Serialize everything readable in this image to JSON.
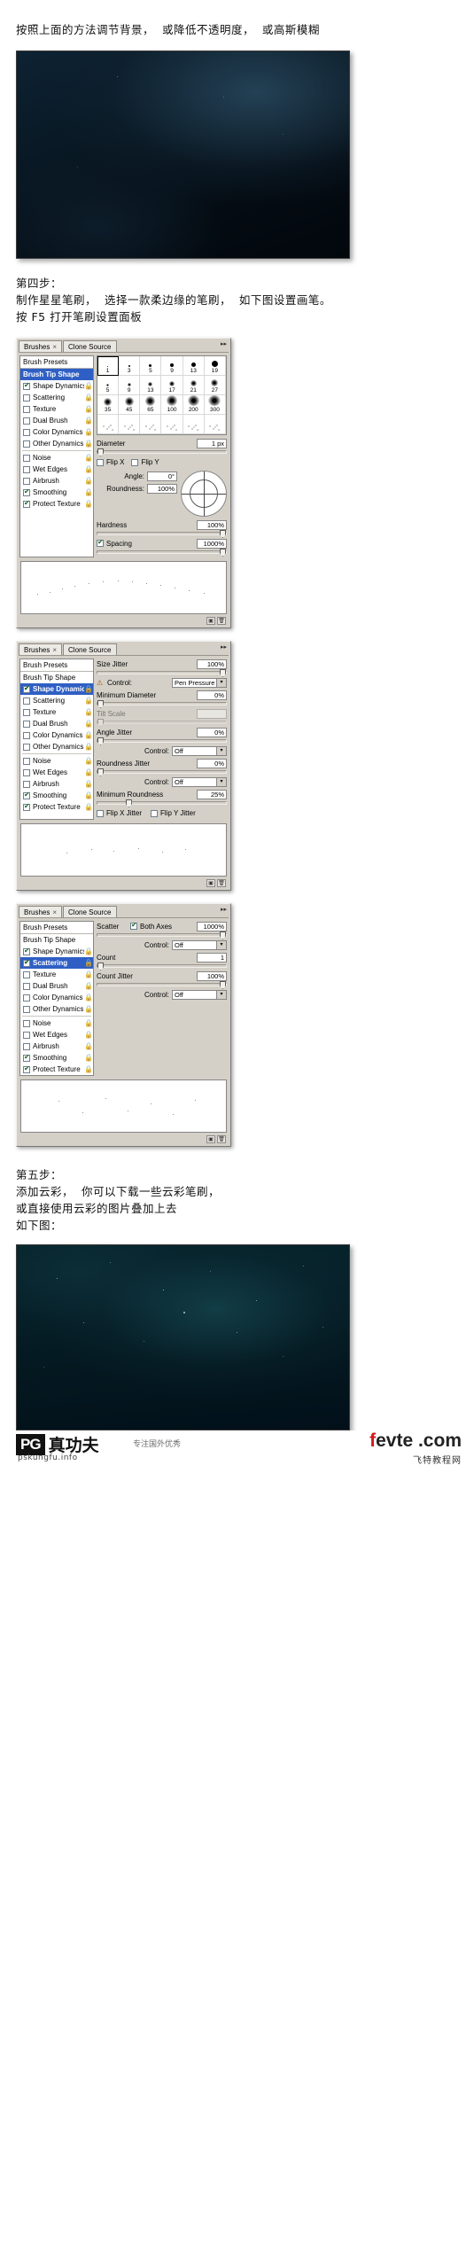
{
  "intro": {
    "line1": "按照上面的方法调节背景，  或降低不透明度，  或高斯模糊"
  },
  "step4": {
    "heading": "第四步：",
    "line1": "制作星星笔刷，  选择一款柔边缘的笔刷，  如下图设置画笔。",
    "line2": "按 F5 打开笔刷设置面板"
  },
  "step5": {
    "heading": "第五步：",
    "line1": "添加云彩，  你可以下载一些云彩笔刷，",
    "line2": "或直接使用云彩的图片叠加上去",
    "line3": "如下图："
  },
  "panel_common": {
    "tabs": [
      {
        "label": "Brushes",
        "close": "×",
        "active": true
      },
      {
        "label": "Clone Source",
        "close": "",
        "active": false
      }
    ],
    "menu_icon": "panel-menu-icon",
    "presets_label": "Brush Presets",
    "left_items": [
      {
        "label": "Brush Tip Shape",
        "type": "header",
        "checked": false,
        "locked": true
      },
      {
        "label": "Shape Dynamics",
        "type": "check",
        "checked": true,
        "locked": true
      },
      {
        "label": "Scattering",
        "type": "check",
        "checked": false,
        "locked": true
      },
      {
        "label": "Texture",
        "type": "check",
        "checked": false,
        "locked": true
      },
      {
        "label": "Dual Brush",
        "type": "check",
        "checked": false,
        "locked": true
      },
      {
        "label": "Color Dynamics",
        "type": "check",
        "checked": false,
        "locked": true
      },
      {
        "label": "Other Dynamics",
        "type": "check",
        "checked": false,
        "locked": true
      },
      {
        "label": "Noise",
        "type": "check",
        "checked": false,
        "locked": true
      },
      {
        "label": "Wet Edges",
        "type": "check",
        "checked": false,
        "locked": true
      },
      {
        "label": "Airbrush",
        "type": "check",
        "checked": false,
        "locked": true
      },
      {
        "label": "Smoothing",
        "type": "check",
        "checked": true,
        "locked": true
      },
      {
        "label": "Protect Texture",
        "type": "check",
        "checked": true,
        "locked": true
      }
    ],
    "brush_sizes": [
      "1",
      "3",
      "5",
      "9",
      "13",
      "19",
      "5",
      "9",
      "13",
      "17",
      "21",
      "27",
      "35",
      "45",
      "65",
      "100",
      "200",
      "300"
    ],
    "selected_brush_index": 0,
    "footer_buttons": [
      "create-new-brush-icon",
      "delete-brush-icon"
    ]
  },
  "panel1": {
    "selected_section": "Brush Tip Shape",
    "diameter_label": "Diameter",
    "diameter_value": "1 px",
    "flip_x_label": "Flip X",
    "flip_y_label": "Flip Y",
    "angle_label": "Angle:",
    "angle_value": "0°",
    "roundness_label": "Roundness:",
    "roundness_value": "100%",
    "hardness_label": "Hardness",
    "hardness_value": "100%",
    "spacing_label": "Spacing",
    "spacing_value": "1000%",
    "spacing_checked": true
  },
  "panel2": {
    "selected_section": "Shape Dynamics",
    "rows": [
      {
        "label": "Size Jitter",
        "value": "100%"
      },
      {
        "label": "Control:",
        "value": "Pen Pressure",
        "type": "select",
        "warn": true
      },
      {
        "label": "Minimum Diameter",
        "value": "0%"
      },
      {
        "label": "Tilt Scale",
        "value": "",
        "disabled": true
      },
      {
        "label": "Angle Jitter",
        "value": "0%"
      },
      {
        "label": "Control:",
        "value": "Off",
        "type": "select"
      },
      {
        "label": "Roundness Jitter",
        "value": "0%"
      },
      {
        "label": "Control:",
        "value": "Off",
        "type": "select"
      },
      {
        "label": "Minimum Roundness",
        "value": "25%"
      }
    ],
    "flip_x_jitter_label": "Flip X Jitter",
    "flip_y_jitter_label": "Flip Y Jitter"
  },
  "panel3": {
    "selected_section": "Scattering",
    "scatter_label": "Scatter",
    "scatter_value": "1000%",
    "both_axes_label": "Both Axes",
    "both_axes_checked": true,
    "rows": [
      {
        "label": "Control:",
        "value": "Off",
        "type": "select"
      },
      {
        "label": "Count",
        "value": "1"
      },
      {
        "label": "Count Jitter",
        "value": "100%"
      },
      {
        "label": "Control:",
        "value": "Off",
        "type": "select"
      }
    ]
  },
  "footer": {
    "pg_badge": "PG",
    "pg_cn": "真功夫",
    "pg_sub": "pskungfu.info",
    "watermark_mid": "专注国外优秀",
    "fevte_f": "f",
    "fevte_rest": "evte .com",
    "fevte_sub": "飞特教程网"
  },
  "colors": {
    "panel_bg": "#d4d0c8",
    "selection_blue": "#2f5fc4",
    "accent_red": "#d11a1a",
    "hero_dark": "#081722"
  }
}
